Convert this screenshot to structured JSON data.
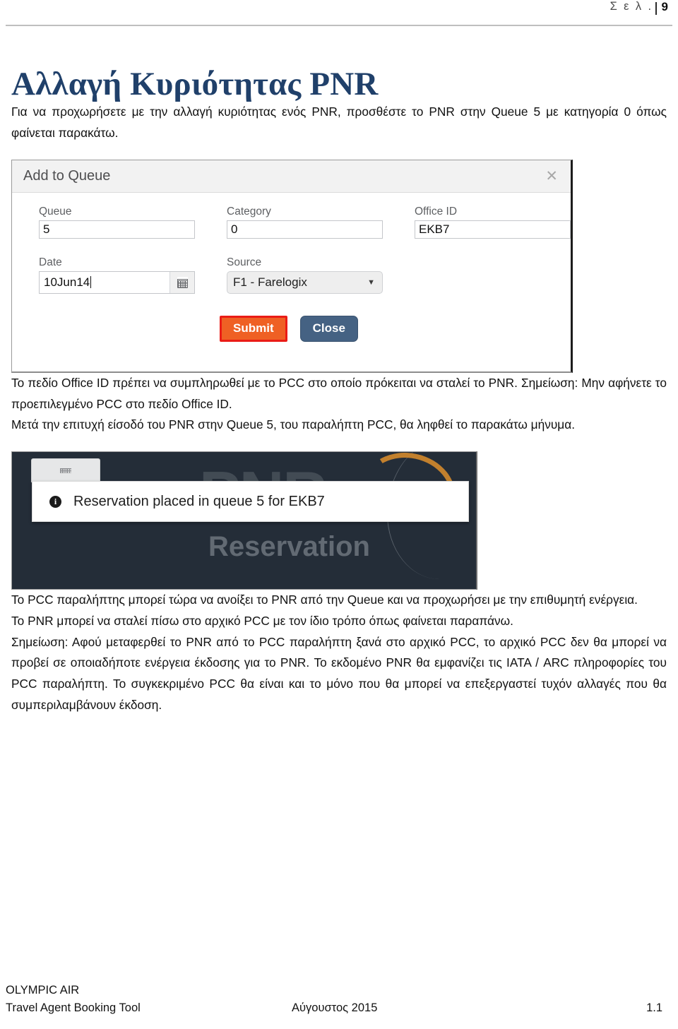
{
  "header": {
    "page_label": "Σ ε λ .",
    "page_number": "9"
  },
  "title": "Αλλαγή Κυριότητας PNR",
  "paragraphs": {
    "intro": "Για να προχωρήσετε με την αλλαγή κυριότητας ενός PNR, προσθέστε το PNR στην Queue 5 με κατηγορία 0 όπως φαίνεται παρακάτω.",
    "after_dialog_1": "Το πεδίο Office ID πρέπει να συμπληρωθεί με το PCC στο οποίο πρόκειται να σταλεί  το PNR. Σημείωση: Μην αφήνετε το προεπιλεγμένο PCC στο πεδίο Office ID.",
    "after_dialog_2": "Μετά την επιτυχή είσοδό του PNR στην Queue 5, του παραλήπτη PCC, θα ληφθεί το παρακάτω μήνυμα.",
    "after_toast_1": "Το PCC παραλήπτης μπορεί τώρα να ανοίξει το PNR από την Queue και να προχωρήσει με την επιθυμητή ενέργεια.",
    "after_toast_2": "Το PNR μπορεί να σταλεί πίσω στο αρχικό PCC με τον ίδιο τρόπο όπως φαίνεται παραπάνω.",
    "after_toast_3": "Σημείωση: Αφού μεταφερθεί το PNR από το PCC παραλήπτη ξανά στο αρχικό PCC, το αρχικό PCC δεν θα μπορεί να προβεί σε οποιαδήποτε ενέργεια έκδοσης για το PNR.  Το εκδομένο PNR θα εμφανίζει τις ΙΑΤΑ / ARC πληροφορίες του PCC παραλήπτη. Το συγκεκριμένο PCC θα είναι και το  μόνο που θα μπορεί να επεξεργαστεί τυχόν αλλαγές που θα συμπεριλαμβάνουν έκδοση."
  },
  "dialog": {
    "title": "Add to Queue",
    "close_icon": "✕",
    "fields": {
      "queue": {
        "label": "Queue",
        "value": "5"
      },
      "category": {
        "label": "Category",
        "value": "0"
      },
      "office_id": {
        "label": "Office ID",
        "value": "EKB7"
      },
      "date": {
        "label": "Date",
        "value": "10Jun14"
      },
      "source": {
        "label": "Source",
        "value": "F1 - Farelogix",
        "arrow": "▼"
      }
    },
    "buttons": {
      "submit": "Submit",
      "close": "Close"
    },
    "colors": {
      "submit_bg": "#ef6024",
      "submit_border": "#ea1c16",
      "close_bg": "#456283"
    }
  },
  "toast": {
    "info_glyph": "i",
    "message": "Reservation placed in queue 5 for EKB7",
    "background_word_1": "PNR",
    "background_word_2": "Reservation",
    "background_color": "#242d38"
  },
  "footer": {
    "company": "OLYMPIC AIR",
    "product": "Travel Agent Booking Tool",
    "date": "Αύγουστος 2015",
    "version": "1.1"
  }
}
